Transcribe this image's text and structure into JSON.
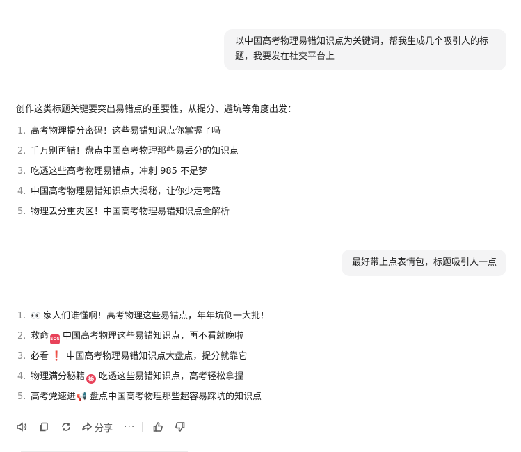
{
  "messages": {
    "user1": {
      "text": "以中国高考物理易错知识点为关键词，帮我生成几个吸引人的标题，我要发在社交平台上"
    },
    "answer1": {
      "intro": "创作这类标题关键要突出易错点的重要性，从提分、避坑等角度出发：",
      "items": [
        {
          "num": "1.",
          "text": "高考物理提分密码！这些易错知识点你掌握了吗"
        },
        {
          "num": "2.",
          "text": "千万别再错！盘点中国高考物理那些易丢分的知识点"
        },
        {
          "num": "3.",
          "text": "吃透这些高考物理易错点，冲刺 985 不是梦"
        },
        {
          "num": "4.",
          "text": "中国高考物理易错知识点大揭秘，让你少走弯路"
        },
        {
          "num": "5.",
          "text": "物理丢分重灾区！中国高考物理易错知识点全解析"
        }
      ]
    },
    "user2": {
      "text": "最好带上点表情包，标题吸引人一点"
    },
    "answer2": {
      "items": [
        {
          "num": "1.",
          "emoji": "👀",
          "text": "家人们谁懂啊！高考物理这些易错点，年年坑倒一大批！"
        },
        {
          "num": "2.",
          "prefix": "救命",
          "emoji": "SOS",
          "text": "中国高考物理这些易错知识点，再不看就晚啦"
        },
        {
          "num": "3.",
          "prefix": "必看",
          "emoji": "❗",
          "text": "中国高考物理易错知识点大盘点，提分就靠它"
        },
        {
          "num": "4.",
          "prefix": "物理满分秘籍",
          "emoji": "秘",
          "text": "吃透这些易错知识点，高考轻松拿捏"
        },
        {
          "num": "5.",
          "prefix": "高考党速进",
          "emoji": "📢",
          "text": "盘点中国高考物理那些超容易踩坑的知识点"
        }
      ]
    }
  },
  "toolbar": {
    "share_label": "分享",
    "more_label": "···",
    "icons": [
      "speaker-icon",
      "copy-icon",
      "refresh-icon",
      "share-icon",
      "more-icon",
      "thumbs-up-icon",
      "thumbs-down-icon"
    ]
  },
  "colors": {
    "bubble_bg": "#f4f4f5",
    "number_gray": "#8a8a8a",
    "emoji_red": "#e8425a"
  }
}
